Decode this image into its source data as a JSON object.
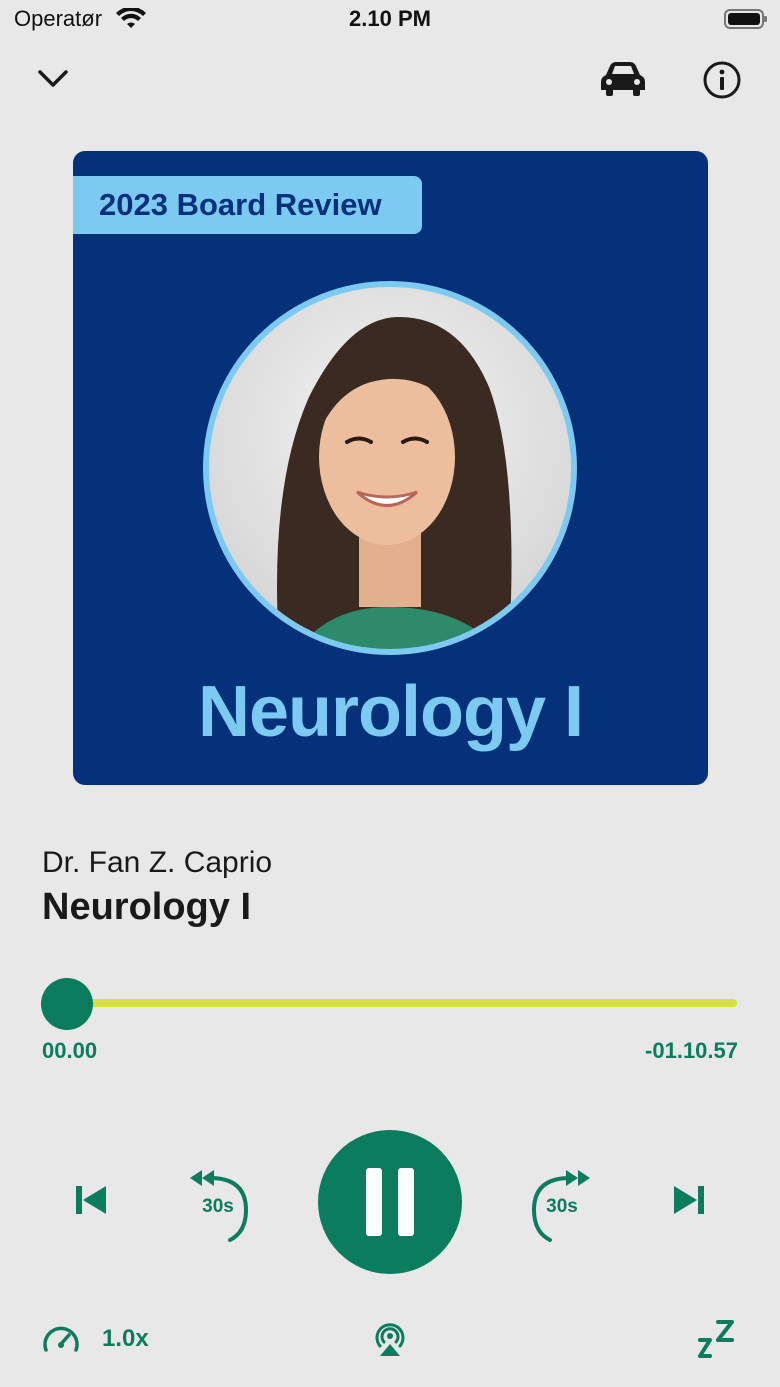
{
  "status_bar": {
    "carrier": "Operatør",
    "time": "2.10 PM"
  },
  "nav": {
    "icons": [
      "chevron-down-icon",
      "car-icon",
      "info-icon"
    ]
  },
  "artwork": {
    "badge": "2023 Board Review",
    "title": "Neurology I",
    "background_color": "#04317a",
    "accent_color": "#7ccaf1"
  },
  "track": {
    "author": "Dr. Fan Z. Caprio",
    "title": "Neurology I"
  },
  "progress": {
    "elapsed": "00.00",
    "remaining": "-01.10.57",
    "fraction": 0.0
  },
  "controls": {
    "rewind_label": "30s",
    "forward_label": "30s",
    "state": "playing"
  },
  "bottom_bar": {
    "speed": "1.0x"
  },
  "colors": {
    "primary": "#0b7d5e",
    "progress": "#d7e03c",
    "background": "#e8e8e8"
  }
}
